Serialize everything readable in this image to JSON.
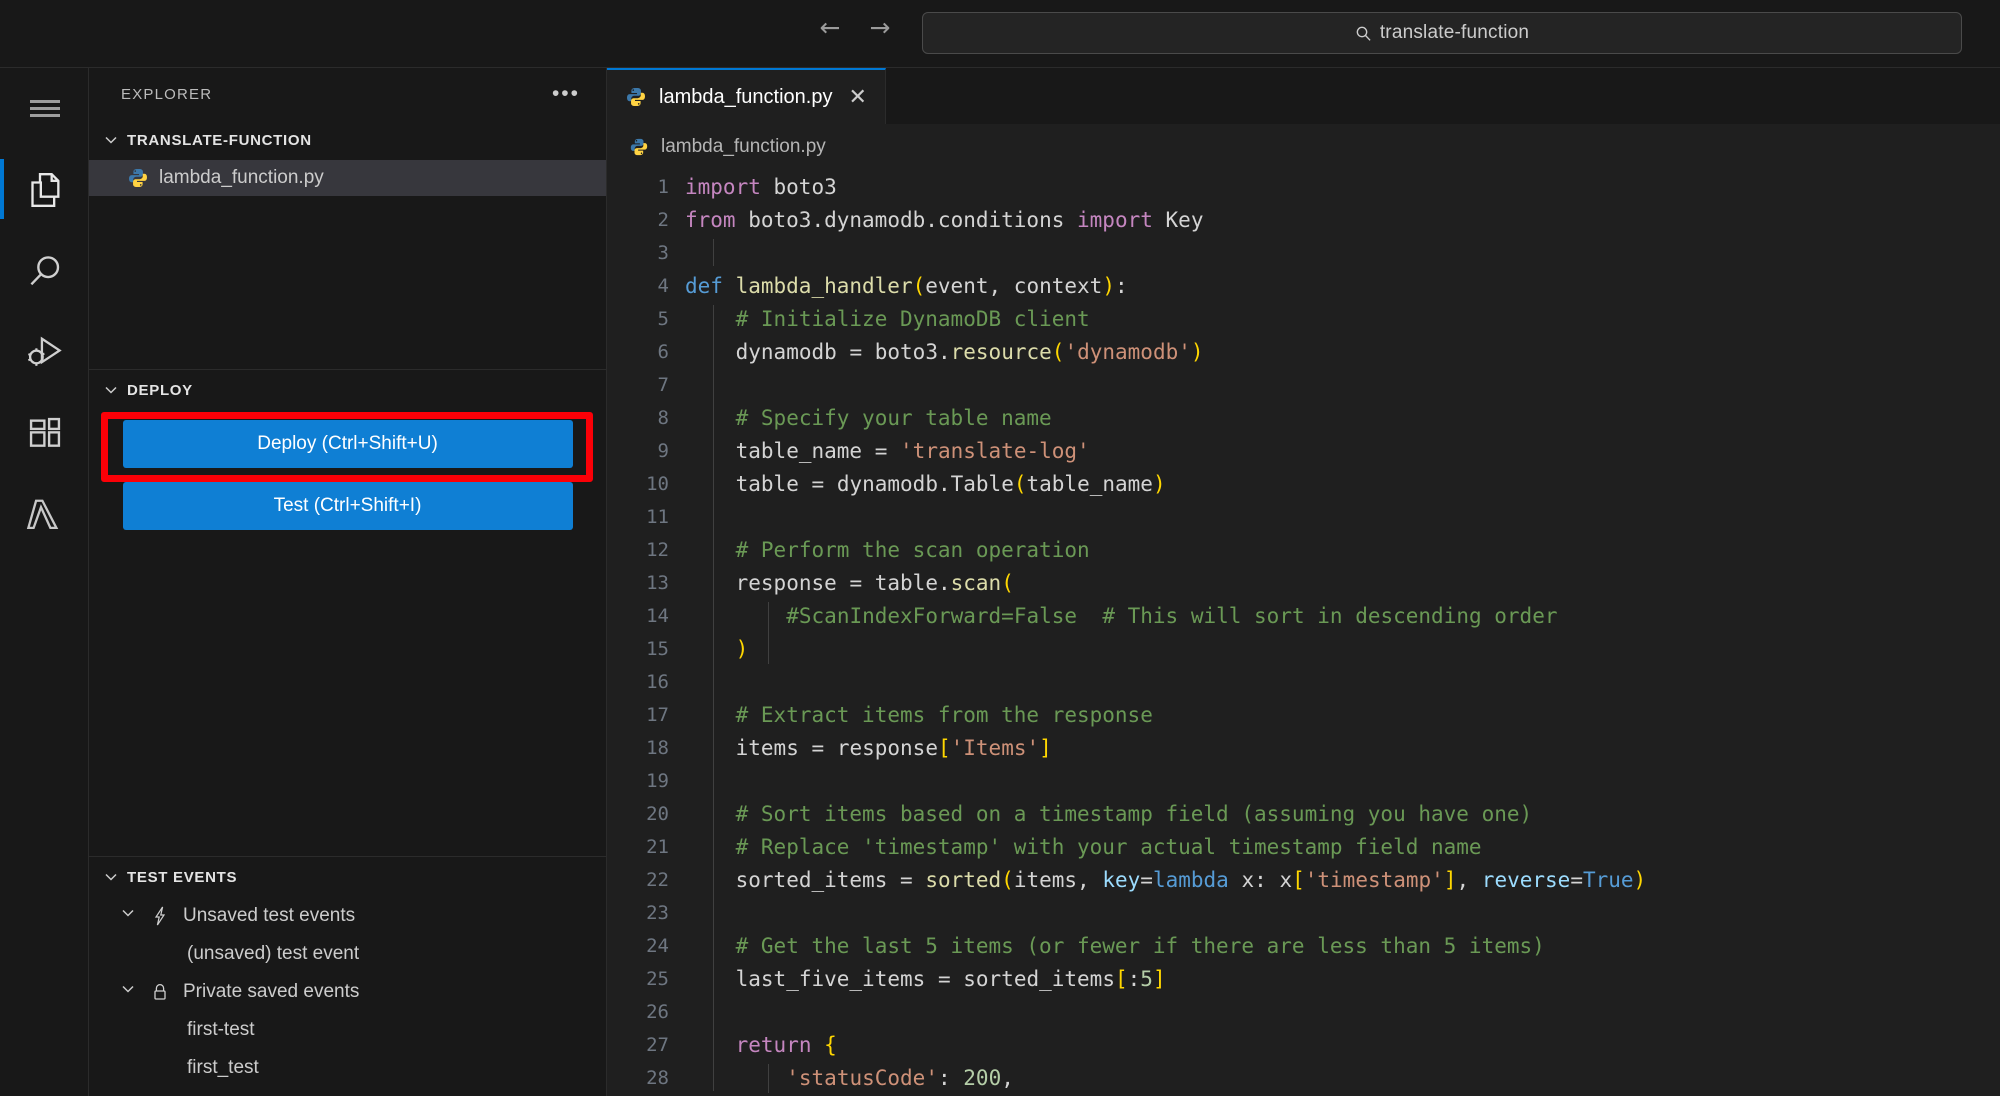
{
  "titlebar": {
    "back_label": "←",
    "forward_label": "→",
    "search": {
      "icon": "search-icon",
      "value": "translate-function",
      "placeholder": "Search"
    }
  },
  "activitybar": {
    "items": [
      {
        "icon": "hamburger-menu-icon",
        "label": "Menu",
        "active": false
      },
      {
        "icon": "files-explorer-icon",
        "label": "Explorer",
        "active": true
      },
      {
        "icon": "search-icon",
        "label": "Search",
        "active": false
      },
      {
        "icon": "run-and-debug-icon",
        "label": "Run and Debug",
        "active": false
      },
      {
        "icon": "extensions-icon",
        "label": "Extensions",
        "active": false
      },
      {
        "icon": "lambda-icon",
        "label": "AWS Lambda",
        "active": false
      }
    ]
  },
  "sidebar": {
    "title": "EXPLORER",
    "more_label": "•••",
    "explorer": {
      "section_label": "TRANSLATE-FUNCTION",
      "twisty": "⌄",
      "files": [
        {
          "name": "lambda_function.py",
          "icon": "python-file-icon",
          "selected": true
        }
      ]
    },
    "deploy": {
      "section_label": "DEPLOY",
      "twisty": "⌄",
      "buttons": [
        {
          "label": "Deploy (Ctrl+Shift+U)",
          "name": "deploy-button",
          "highlighted": true
        },
        {
          "label": "Test (Ctrl+Shift+I)",
          "name": "test-button",
          "highlighted": false
        }
      ],
      "highlight_color": "#fb0007",
      "button_color": "#0f7fd4"
    },
    "test_events": {
      "section_label": "TEST EVENTS",
      "twisty": "⌄",
      "groups": [
        {
          "label": "Unsaved test events",
          "icon": "lightning-bolt-icon",
          "twisty": "⌄",
          "children": [
            "(unsaved) test event"
          ]
        },
        {
          "label": "Private saved events",
          "icon": "lock-icon",
          "twisty": "⌄",
          "children": [
            "first-test",
            "first_test"
          ]
        }
      ]
    }
  },
  "editor": {
    "tab": {
      "title": "lambda_function.py",
      "icon": "python-file-icon",
      "close_label": "✕"
    },
    "breadcrumb": {
      "icon": "python-file-icon",
      "label": "lambda_function.py"
    },
    "accent_color": "#0078d4",
    "lines": [
      {
        "n": 1,
        "text": "import boto3"
      },
      {
        "n": 2,
        "text": "from boto3.dynamodb.conditions import Key"
      },
      {
        "n": 3,
        "text": ""
      },
      {
        "n": 4,
        "text": "def lambda_handler(event, context):"
      },
      {
        "n": 5,
        "text": "    # Initialize DynamoDB client"
      },
      {
        "n": 6,
        "text": "    dynamodb = boto3.resource('dynamodb')"
      },
      {
        "n": 7,
        "text": ""
      },
      {
        "n": 8,
        "text": "    # Specify your table name"
      },
      {
        "n": 9,
        "text": "    table_name = 'translate-log'"
      },
      {
        "n": 10,
        "text": "    table = dynamodb.Table(table_name)"
      },
      {
        "n": 11,
        "text": ""
      },
      {
        "n": 12,
        "text": "    # Perform the scan operation"
      },
      {
        "n": 13,
        "text": "    response = table.scan("
      },
      {
        "n": 14,
        "text": "        #ScanIndexForward=False  # This will sort in descending order"
      },
      {
        "n": 15,
        "text": "    )"
      },
      {
        "n": 16,
        "text": ""
      },
      {
        "n": 17,
        "text": "    # Extract items from the response"
      },
      {
        "n": 18,
        "text": "    items = response['Items']"
      },
      {
        "n": 19,
        "text": ""
      },
      {
        "n": 20,
        "text": "    # Sort items based on a timestamp field (assuming you have one)"
      },
      {
        "n": 21,
        "text": "    # Replace 'timestamp' with your actual timestamp field name"
      },
      {
        "n": 22,
        "text": "    sorted_items = sorted(items, key=lambda x: x['timestamp'], reverse=True)"
      },
      {
        "n": 23,
        "text": ""
      },
      {
        "n": 24,
        "text": "    # Get the last 5 items (or fewer if there are less than 5 items)"
      },
      {
        "n": 25,
        "text": "    last_five_items = sorted_items[:5]"
      },
      {
        "n": 26,
        "text": ""
      },
      {
        "n": 27,
        "text": "    return {"
      },
      {
        "n": 28,
        "text": "        'statusCode': 200,"
      }
    ]
  }
}
